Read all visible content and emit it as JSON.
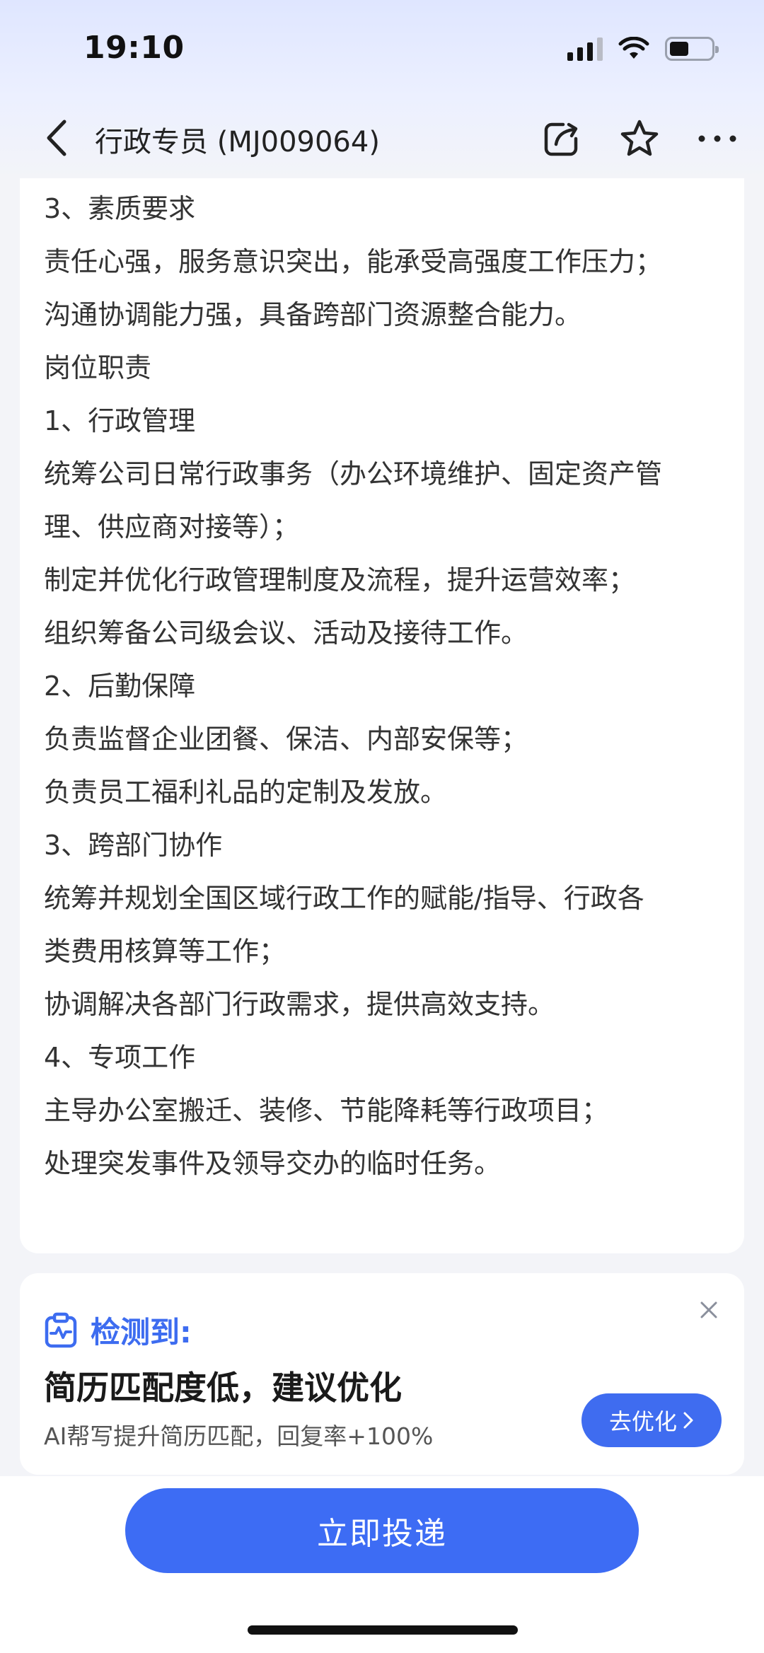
{
  "status_bar": {
    "time": "19:10"
  },
  "nav": {
    "title": "行政专员 (MJ009064)"
  },
  "content": {
    "lines": [
      "3、素质要求",
      "责任心强，服务意识突出，能承受高强度工作压力；",
      "沟通协调能力强，具备跨部门资源整合能力。",
      "岗位职责",
      "1、行政管理",
      "统筹公司日常行政事务（办公环境维护、固定资产管",
      "理、供应商对接等）；",
      "制定并优化行政管理制度及流程，提升运营效率；",
      "组织筹备公司级会议、活动及接待工作。",
      "2、后勤保障",
      "负责监督企业团餐、保洁、内部安保等；",
      "负责员工福利礼品的定制及发放。",
      "3、跨部门协作",
      "统筹并规划全国区域行政工作的赋能/指导、行政各",
      "类费用核算等工作；",
      "协调解决各部门行政需求，提供高效支持。",
      "4、专项工作",
      "主导办公室搬迁、装修、节能降耗等行政项目；",
      "处理突发事件及领导交办的临时任务。"
    ]
  },
  "detect": {
    "label": "检测到:",
    "title": "简历匹配度低，建议优化",
    "subtitle": "AI帮写提升简历匹配，回复率+100%",
    "button_label": "去优化"
  },
  "bottom": {
    "apply_label": "立即投递"
  },
  "colors": {
    "accent": "#3d6cf4",
    "background": "#f3f4f8"
  }
}
